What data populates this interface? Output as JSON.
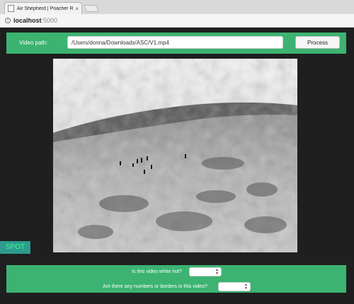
{
  "browser": {
    "tab_title": "Air Shepherd | Poacher Recog",
    "tab_close": "×",
    "url_host": "localhost",
    "url_port": ":5000",
    "info_icon": "i"
  },
  "form": {
    "path_label": "Video path:",
    "path_value": "/Users/donna/Downloads/ASC/V1.mp4",
    "process_label": "Process"
  },
  "spot_button": "SPOT",
  "questions": {
    "q1": "Is this video white hot?",
    "q2": "Are there any numbers or borders in this video?",
    "q1_value": "",
    "q2_value": ""
  },
  "colors": {
    "accent_green": "#3cb371",
    "background": "#1f1f1f",
    "spot_bg": "#2e9b8e",
    "spot_text": "#3cff8a"
  }
}
